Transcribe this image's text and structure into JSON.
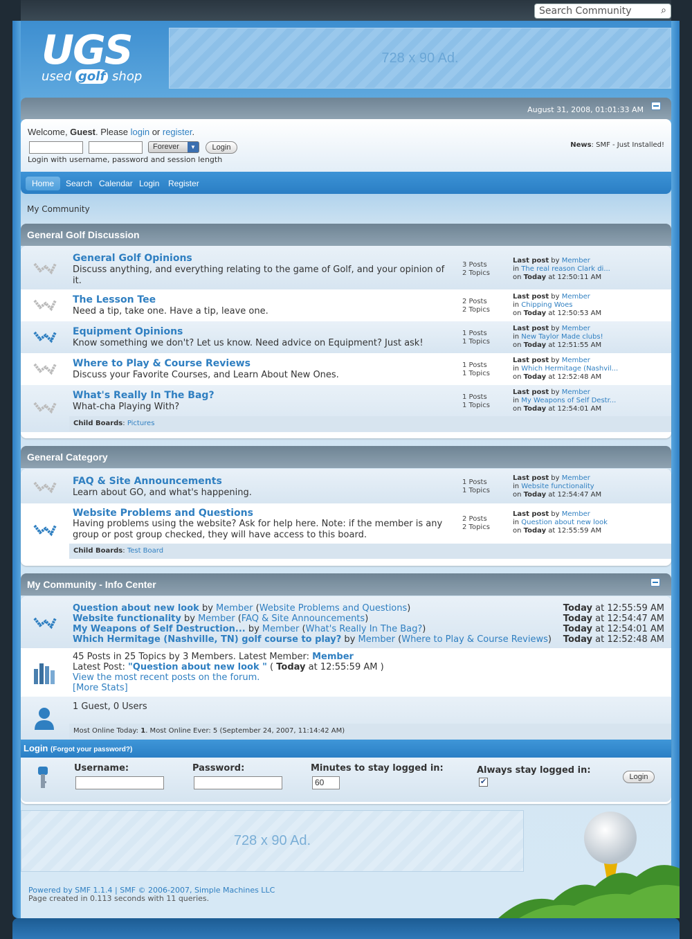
{
  "search": {
    "placeholder": "Search Community"
  },
  "logo": {
    "big": "UGS",
    "word1": "used",
    "word2": "golf",
    "word3": "shop"
  },
  "ads": {
    "top": "728 x 90 Ad.",
    "bottom": "728 x 90 Ad."
  },
  "userpanel": {
    "date": "August 31, 2008, 01:01:33 AM",
    "welcome_prefix": "Welcome, ",
    "guest": "Guest",
    "please": ". Please ",
    "login_link": "login",
    "or": " or ",
    "register_link": "register",
    "period": ".",
    "duration": "Forever",
    "login_button": "Login",
    "hint": "Login with username, password and session length",
    "news_label": "News",
    "news_text": ": SMF - Just Installed!"
  },
  "nav": [
    "Home",
    "Search",
    "Calendar",
    "Login",
    "Register"
  ],
  "linktree": "My Community",
  "categories": [
    {
      "title": "General Golf Discussion",
      "boards": [
        {
          "title": "General Golf Opinions",
          "desc": "Discuss anything, and everything relating to the game of Golf, and your opinion of it.",
          "posts": "3 Posts",
          "topics": "2 Topics",
          "by": "Member",
          "in": "The real reason Clark di...",
          "on": "Today",
          "time": " at 12:50:11 AM"
        },
        {
          "title": "The Lesson Tee",
          "desc": "Need a tip, take one. Have a tip, leave one.",
          "posts": "2 Posts",
          "topics": "2 Topics",
          "by": "Member",
          "in": "Chipping Woes",
          "on": "Today",
          "time": " at 12:50:53 AM"
        },
        {
          "title": "Equipment Opinions",
          "desc": "Know something we don't? Let us know. Need advice on Equipment? Just ask!",
          "posts": "1 Posts",
          "topics": "1 Topics",
          "by": "Member",
          "in": "New Taylor Made clubs!",
          "on": "Today",
          "time": " at 12:51:55 AM"
        },
        {
          "title": "Where to Play & Course Reviews",
          "desc": "Discuss your Favorite Courses, and Learn About New Ones.",
          "posts": "1 Posts",
          "topics": "1 Topics",
          "by": "Member",
          "in": "Which Hermitage (Nashvil...",
          "on": "Today",
          "time": " at 12:52:48 AM"
        },
        {
          "title": "What's Really In The Bag?",
          "desc": "What-cha Playing With?",
          "posts": "1 Posts",
          "topics": "1 Topics",
          "by": "Member",
          "in": "My Weapons of Self Destr...",
          "on": "Today",
          "time": " at 12:54:01 AM"
        }
      ],
      "child_label": "Child Boards",
      "child_link": "Pictures"
    },
    {
      "title": "General Category",
      "boards": [
        {
          "title": "FAQ & Site Announcements",
          "desc": "Learn about GO, and what's happening.",
          "posts": "1 Posts",
          "topics": "1 Topics",
          "by": "Member",
          "in": "Website functionality",
          "on": "Today",
          "time": " at 12:54:47 AM"
        },
        {
          "title": "Website Problems and Questions",
          "desc": "Having problems using the website? Ask for help here. Note: if the member is any group or post group checked, they will have access to this board.",
          "posts": "2 Posts",
          "topics": "2 Topics",
          "by": "Member",
          "in": "Question about new look",
          "on": "Today",
          "time": " at 12:55:59 AM"
        }
      ],
      "child_label": "Child Boards",
      "child_link": "Test Board"
    }
  ],
  "board_labels": {
    "last_post": "Last post",
    "by": " by ",
    "in": "in ",
    "on": "on "
  },
  "info_center": {
    "title": "My Community - Info Center",
    "recent": [
      {
        "topic": "Question about new look",
        "by": " by ",
        "member": "Member",
        "board": "Website Problems and Questions",
        "day": "Today",
        "time": " at 12:55:59 AM"
      },
      {
        "topic": "Website functionality",
        "by": " by ",
        "member": "Member",
        "board": "FAQ & Site Announcements",
        "day": "Today",
        "time": " at 12:54:47 AM"
      },
      {
        "topic": "My Weapons of Self Destruction...",
        "by": " by ",
        "member": "Member",
        "board": "What's Really In The Bag?",
        "day": "Today",
        "time": " at 12:54:01 AM"
      },
      {
        "topic": "Which Hermitage (Nashville, TN) golf course to play?",
        "by": " by ",
        "member": "Member",
        "board": "Where to Play & Course Reviews",
        "day": "Today",
        "time": " at 12:52:48 AM"
      }
    ],
    "stats_line": "45 Posts in 25 Topics by 3 Members. Latest Member: ",
    "latest_member": "Member",
    "latest_post_label": "Latest Post: ",
    "latest_post": "\"Question about new look \"",
    "latest_post_open": " ( ",
    "latest_post_day": "Today",
    "latest_post_time": " at 12:55:59 AM )",
    "recent_link": "View the most recent posts on the forum.",
    "more_stats": "[More Stats]",
    "online": "1 Guest, 0 Users",
    "most_online_prefix": "Most Online Today: ",
    "most_online_today": "1",
    "most_online_suffix": ". Most Online Ever: 5 (September 24, 2007, 11:14:42 AM)"
  },
  "login_box": {
    "title": "Login",
    "forgot": "(Forgot your password?)",
    "username": "Username:",
    "password": "Password:",
    "minutes": "Minutes to stay logged in:",
    "minutes_value": "60",
    "always": "Always stay logged in:",
    "button": "Login"
  },
  "footer": {
    "line1": "Powered by SMF 1.1.4 | SMF © 2006-2007, Simple Machines LLC",
    "line2": "Page created in 0.113 seconds with 11 queries."
  },
  "colors": {
    "accent": "#2f7fc1",
    "header": "#6f8494",
    "nav": "#2a7ec4"
  }
}
